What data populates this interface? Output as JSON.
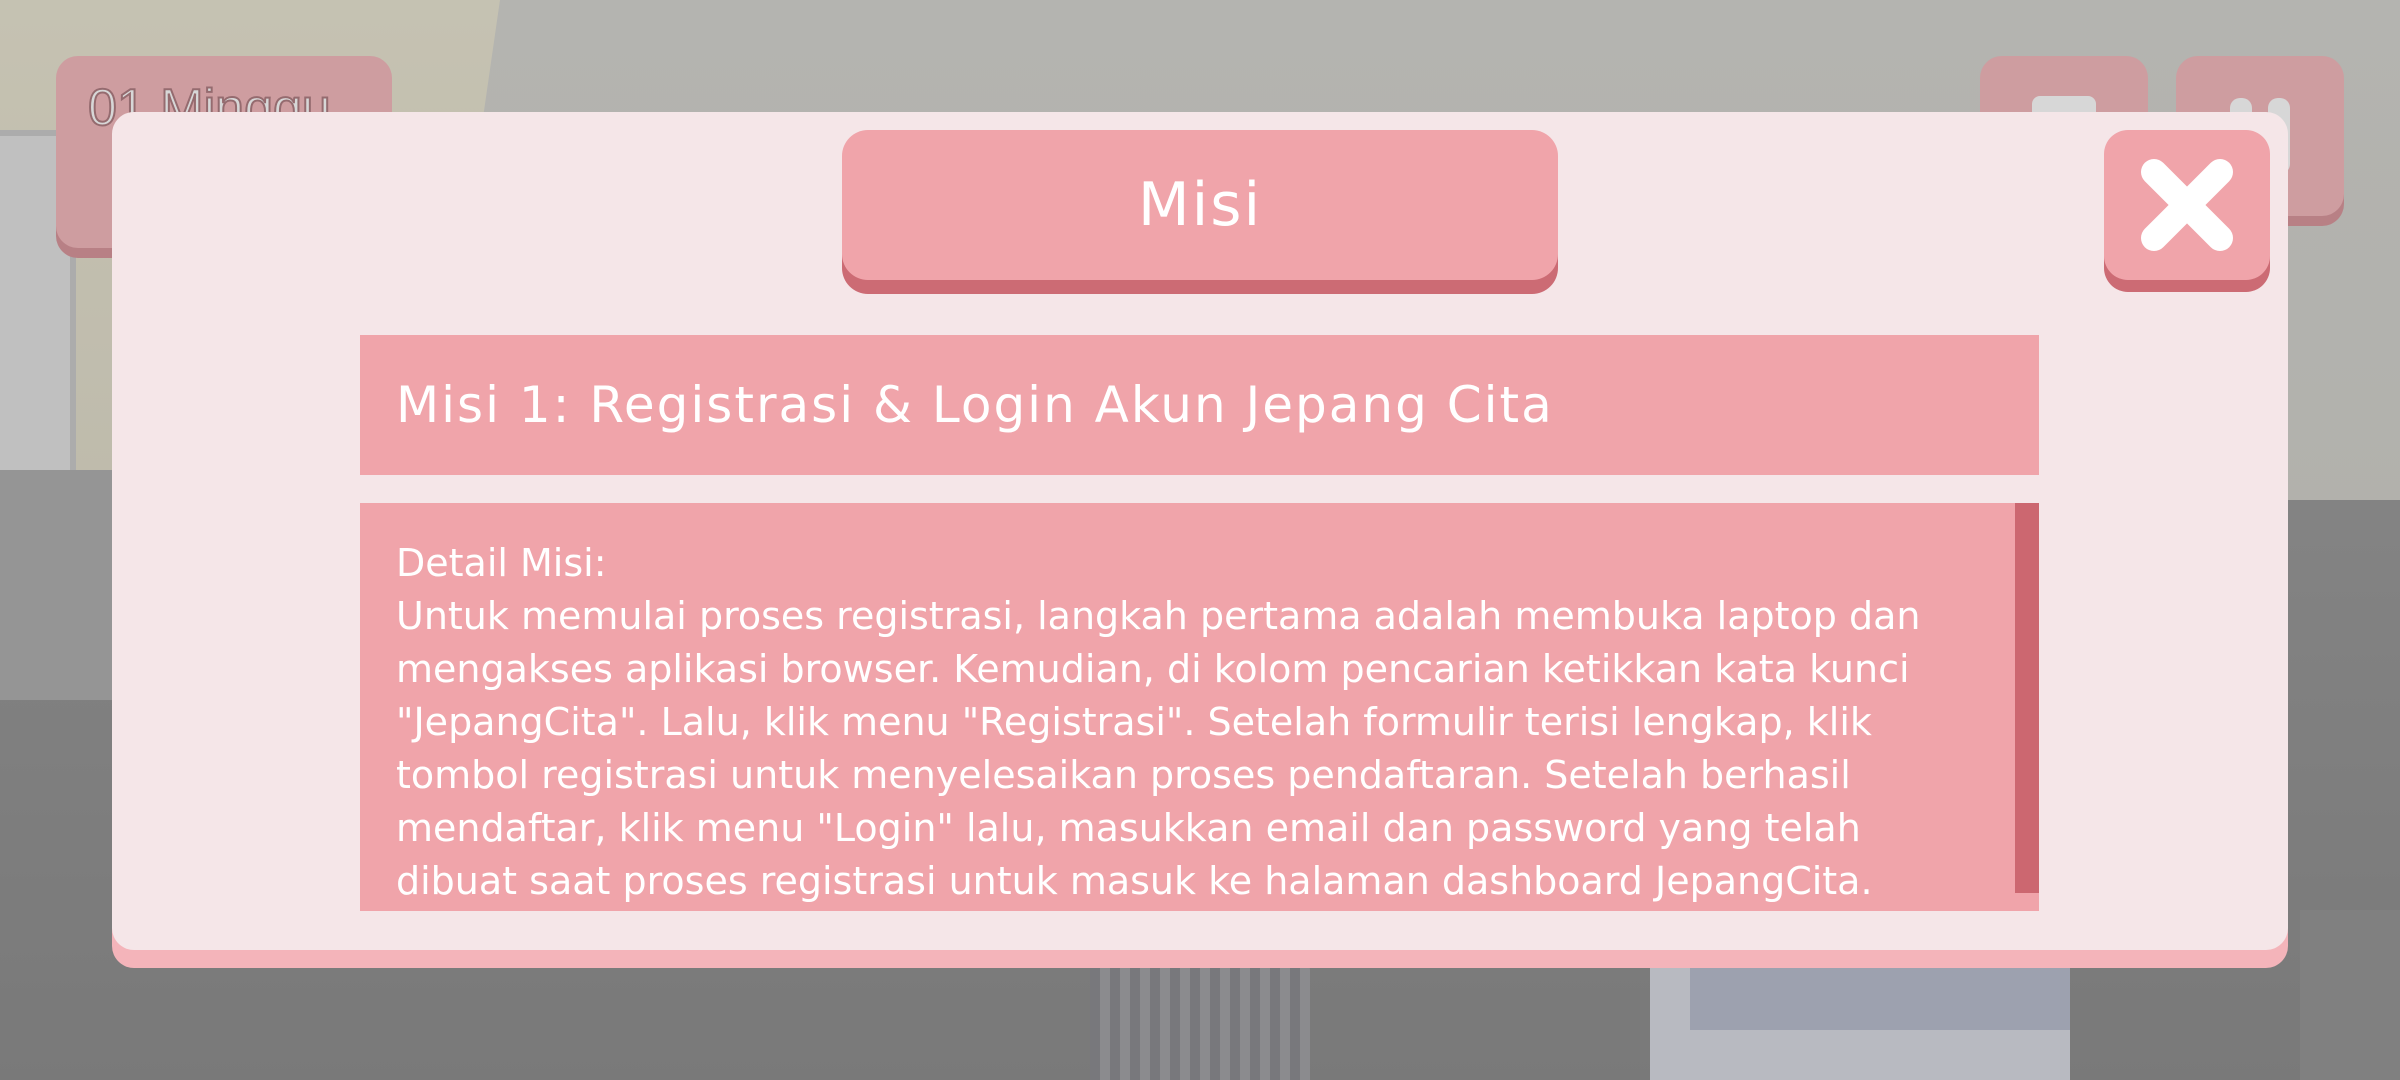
{
  "hud": {
    "week_label": "01 Minggu",
    "buttons": [
      {
        "icon": "document-icon"
      },
      {
        "icon": "pause-icon"
      }
    ]
  },
  "dialog": {
    "title": "Misi",
    "close_icon": "close-icon",
    "mission_title": "Misi 1: Registrasi & Login Akun Jepang Cita",
    "detail_label": "Detail Misi:",
    "detail_body": "Untuk memulai proses registrasi, langkah pertama adalah membuka laptop dan mengakses aplikasi browser. Kemudian, di kolom pencarian ketikkan kata kunci \"JepangCita\". Lalu, klik menu \"Registrasi\". Setelah formulir terisi lengkap, klik tombol registrasi untuk menyelesaikan proses pendaftaran. Setelah berhasil mendaftar, klik menu \"Login\" lalu, masukkan email dan password yang telah dibuat saat proses registrasi untuk masuk ke halaman dashboard JepangCita."
  },
  "colors": {
    "panel": "#f5e6e8",
    "pink": "#f0a4aa",
    "pink_dark": "#cc6b74",
    "text": "#ffffff"
  }
}
